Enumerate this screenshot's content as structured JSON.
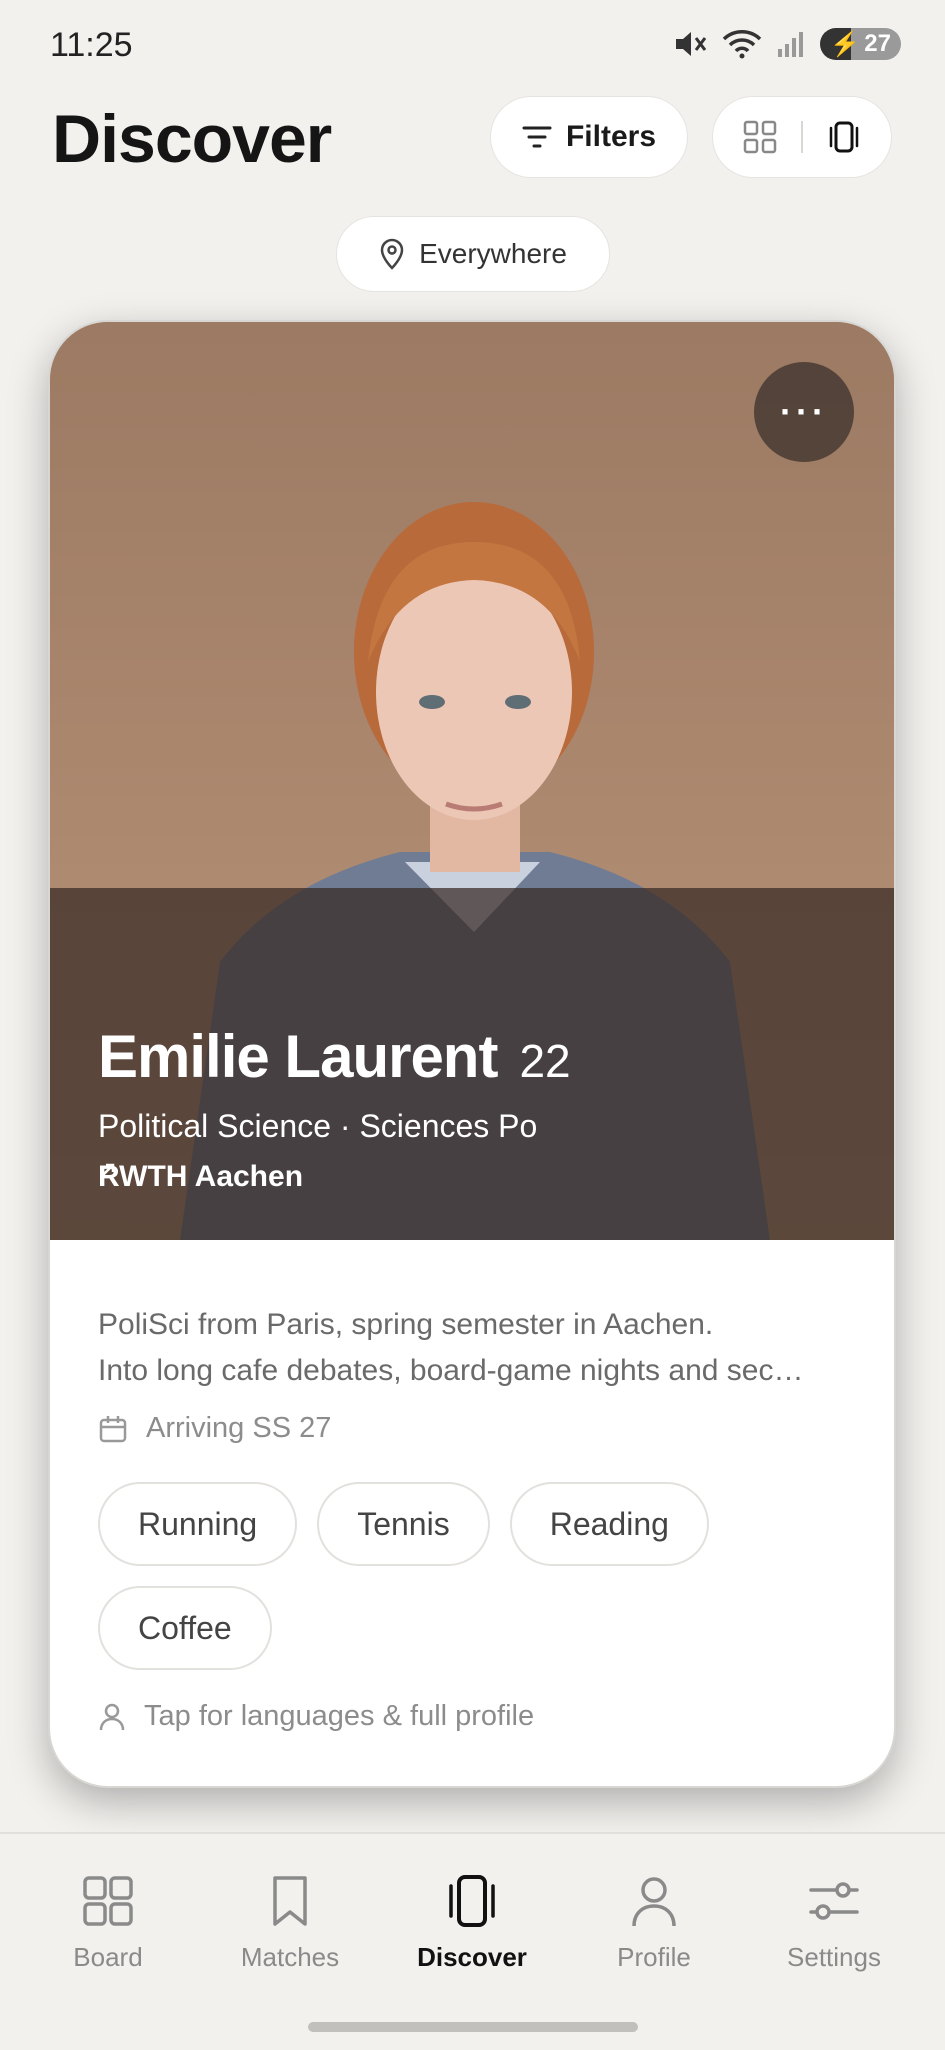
{
  "status": {
    "time": "11:25",
    "battery": "27"
  },
  "header": {
    "title": "Discover",
    "filters_label": "Filters"
  },
  "location": {
    "label": "Everywhere"
  },
  "profile": {
    "name": "Emilie Laurent",
    "age": "22",
    "program": "Political Science · Sciences Po",
    "host_university": "RWTH Aachen",
    "bio_line1": "PoliSci from Paris, spring semester in Aachen.",
    "bio_line2": "Into long cafe debates, board-game nights and sec…",
    "arriving": "Arriving SS 27",
    "interests": [
      "Running",
      "Tennis",
      "Reading",
      "Coffee"
    ],
    "full_profile_hint": "Tap for languages & full profile"
  },
  "nav": {
    "items": [
      {
        "label": "Board",
        "icon": "grid-icon"
      },
      {
        "label": "Matches",
        "icon": "bookmark-icon"
      },
      {
        "label": "Discover",
        "icon": "card-stack-icon",
        "active": true
      },
      {
        "label": "Profile",
        "icon": "person-icon"
      },
      {
        "label": "Settings",
        "icon": "sliders-icon"
      }
    ]
  },
  "colors": {
    "background": "#f2f1ee",
    "accent": "#111111",
    "overlay": "#372a24"
  }
}
